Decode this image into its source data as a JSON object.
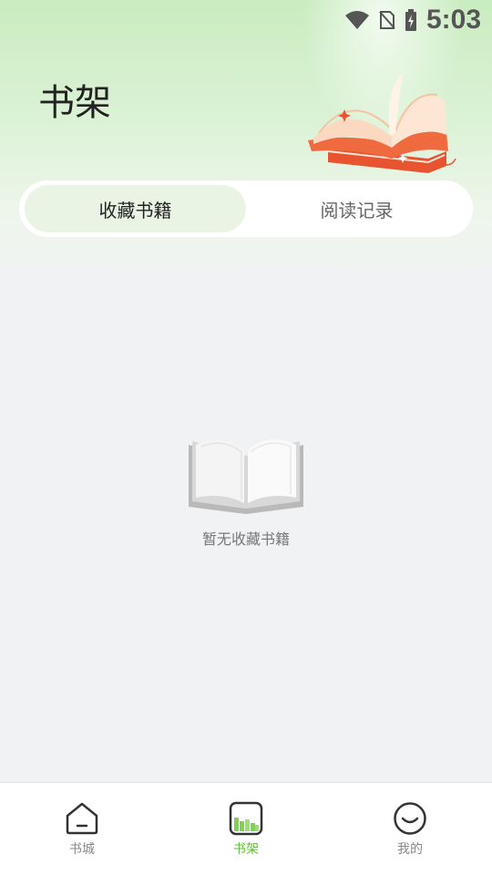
{
  "status_bar": {
    "time": "5:03",
    "icons": [
      "wifi-icon",
      "no-sim-icon",
      "battery-charging-icon"
    ]
  },
  "header": {
    "title": "书架",
    "illustration": "open-book-illustration"
  },
  "tabs": [
    {
      "label": "收藏书籍",
      "selected": true
    },
    {
      "label": "阅读记录",
      "selected": false
    }
  ],
  "empty_state": {
    "icon": "empty-book-icon",
    "message": "暂无收藏书籍"
  },
  "bottom_nav": {
    "items": [
      {
        "label": "书城",
        "icon": "bookstore-icon",
        "active": false
      },
      {
        "label": "书架",
        "icon": "bookshelf-icon",
        "active": true
      },
      {
        "label": "我的",
        "icon": "profile-icon",
        "active": false
      }
    ]
  },
  "colors": {
    "accent": "#5bbf2f",
    "tab_active_bg": "#e9f4e5",
    "header_top": "#c9ecc0",
    "book_red": "#e8542f"
  }
}
